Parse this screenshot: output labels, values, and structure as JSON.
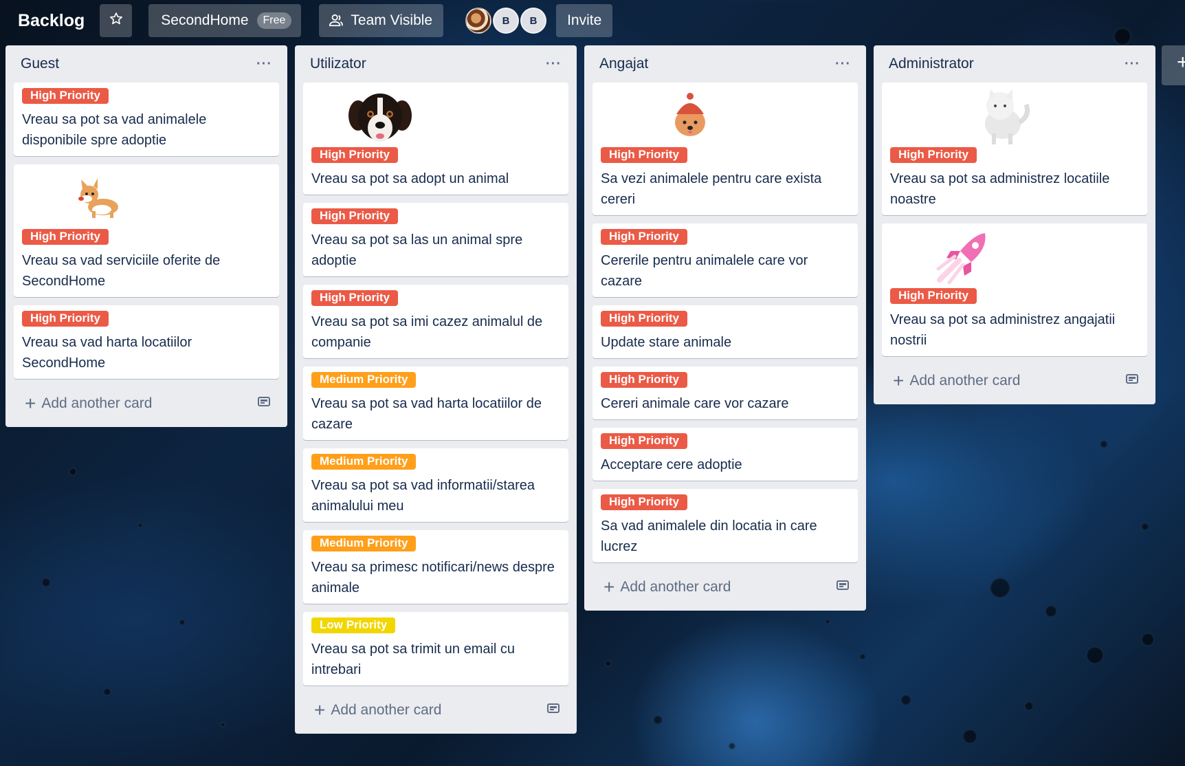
{
  "header": {
    "board_title": "Backlog",
    "workspace": "SecondHome",
    "plan_badge": "Free",
    "visibility": "Team Visible",
    "avatars": [
      "B",
      "B"
    ],
    "invite": "Invite"
  },
  "lists": [
    {
      "title": "Guest",
      "menu": "···",
      "add_card": "Add another card",
      "cards": [
        {
          "label": "High Priority",
          "text": "Vreau sa pot sa vad animalele disponibile spre adoptie"
        },
        {
          "label": "High Priority",
          "text": "Vreau sa vad serviciile oferite de SecondHome",
          "sticker": "corgi-sticker"
        },
        {
          "label": "High Priority",
          "text": "Vreau sa vad harta locatiilor SecondHome"
        }
      ]
    },
    {
      "title": "Utilizator",
      "menu": "···",
      "add_card": "Add another card",
      "cards": [
        {
          "label": "High Priority",
          "text": "Vreau sa pot sa adopt un animal",
          "sticker": "dog-sticker"
        },
        {
          "label": "High Priority",
          "text": "Vreau sa pot sa las un animal spre adoptie"
        },
        {
          "label": "High Priority",
          "text": "Vreau sa pot sa imi cazez animalul de companie"
        },
        {
          "label": "Medium Priority",
          "text": "Vreau sa pot sa vad harta locatiilor de cazare"
        },
        {
          "label": "Medium Priority",
          "text": "Vreau sa pot sa vad informatii/starea animalului meu"
        },
        {
          "label": "Medium Priority",
          "text": "Vreau sa primesc notificari/news despre animale"
        },
        {
          "label": "Low Priority",
          "text": "Vreau sa pot sa trimit un email cu intrebari"
        }
      ]
    },
    {
      "title": "Angajat",
      "menu": "···",
      "add_card": "Add another card",
      "cards": [
        {
          "label": "High Priority",
          "text": "Sa vezi animalele pentru care exista cereri",
          "sticker": "pomeranian-sticker"
        },
        {
          "label": "High Priority",
          "text": "Cererile pentru animalele care vor cazare"
        },
        {
          "label": "High Priority",
          "text": "Update stare animale"
        },
        {
          "label": "High Priority",
          "text": "Cereri animale care vor cazare"
        },
        {
          "label": "High Priority",
          "text": "Acceptare cere adoptie"
        },
        {
          "label": "High Priority",
          "text": "Sa vad animalele din locatia in care lucrez"
        }
      ]
    },
    {
      "title": "Administrator",
      "menu": "···",
      "add_card": "Add another card",
      "cards": [
        {
          "label": "High Priority",
          "text": "Vreau sa pot sa administrez locatiile noastre",
          "sticker": "cat-sticker"
        },
        {
          "label": "High Priority",
          "text": "Vreau sa pot sa administrez angajatii nostrii",
          "sticker": "rocket-sticker"
        }
      ]
    }
  ],
  "add_list": "+"
}
